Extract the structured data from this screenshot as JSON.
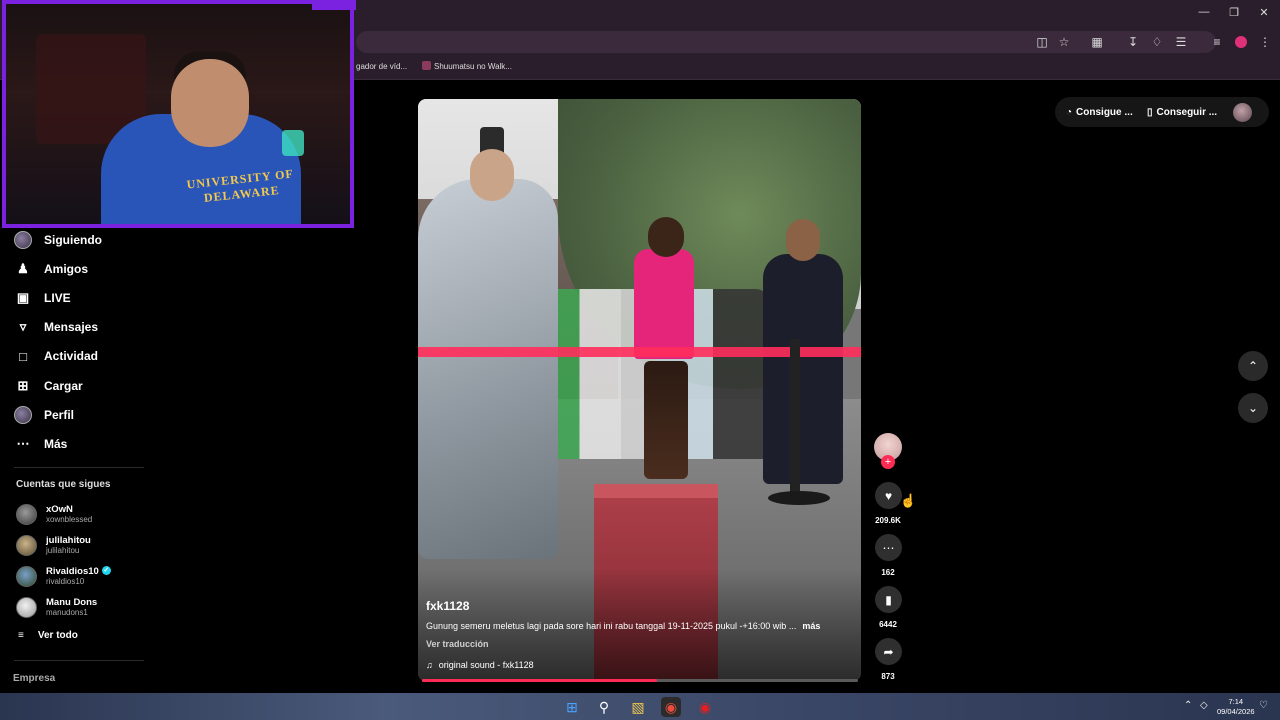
{
  "browser": {
    "bookmarks": [
      "gador de víd...",
      "Shuumatsu no Walk..."
    ],
    "window_controls": [
      "minimize-icon",
      "restore-icon",
      "close-icon"
    ]
  },
  "webcam": {
    "hoodie_text": "UNIVERSITY OF DELAWARE",
    "border_color": "#7a22e0"
  },
  "sidebar": {
    "nav": [
      {
        "label": "Siguiendo",
        "icon": "avatar"
      },
      {
        "label": "Amigos",
        "icon": "friends-icon"
      },
      {
        "label": "LIVE",
        "icon": "live-icon"
      },
      {
        "label": "Mensajes",
        "icon": "messages-icon"
      },
      {
        "label": "Actividad",
        "icon": "activity-icon"
      },
      {
        "label": "Cargar",
        "icon": "upload-icon"
      },
      {
        "label": "Perfil",
        "icon": "avatar"
      },
      {
        "label": "Más",
        "icon": "more-icon"
      }
    ],
    "following_title": "Cuentas que sigues",
    "accounts": [
      {
        "name": "xOwN",
        "handle": "xownblessed",
        "verified": false
      },
      {
        "name": "julilahitou",
        "handle": "julilahitou",
        "verified": false
      },
      {
        "name": "Rivaldios10",
        "handle": "rivaldios10",
        "verified": true
      },
      {
        "name": "Manu Dons",
        "handle": "manudons1",
        "verified": false
      }
    ],
    "see_all": "Ver todo",
    "footer": "Empresa"
  },
  "video": {
    "username": "fxk1128",
    "description": "Gunung semeru meletus lagi pada sore hari ini rabu tanggal 19-11-2025 pukul -+16:00 wib ...",
    "more": "más",
    "translate": "Ver traducción",
    "sound": "original sound - fxk1128",
    "progress": 0.54
  },
  "actions": {
    "likes": "209.6K",
    "comments": "162",
    "saves": "6442",
    "shares": "873"
  },
  "topbar": {
    "coins_label": "Consigue ...",
    "app_label": "Conseguir ..."
  },
  "taskbar": {
    "time": "7:14",
    "date": "09/04/2026"
  },
  "colors": {
    "accent": "#fe2c55",
    "verified": "#20d5ec",
    "chrome": "#2b1e2c"
  }
}
